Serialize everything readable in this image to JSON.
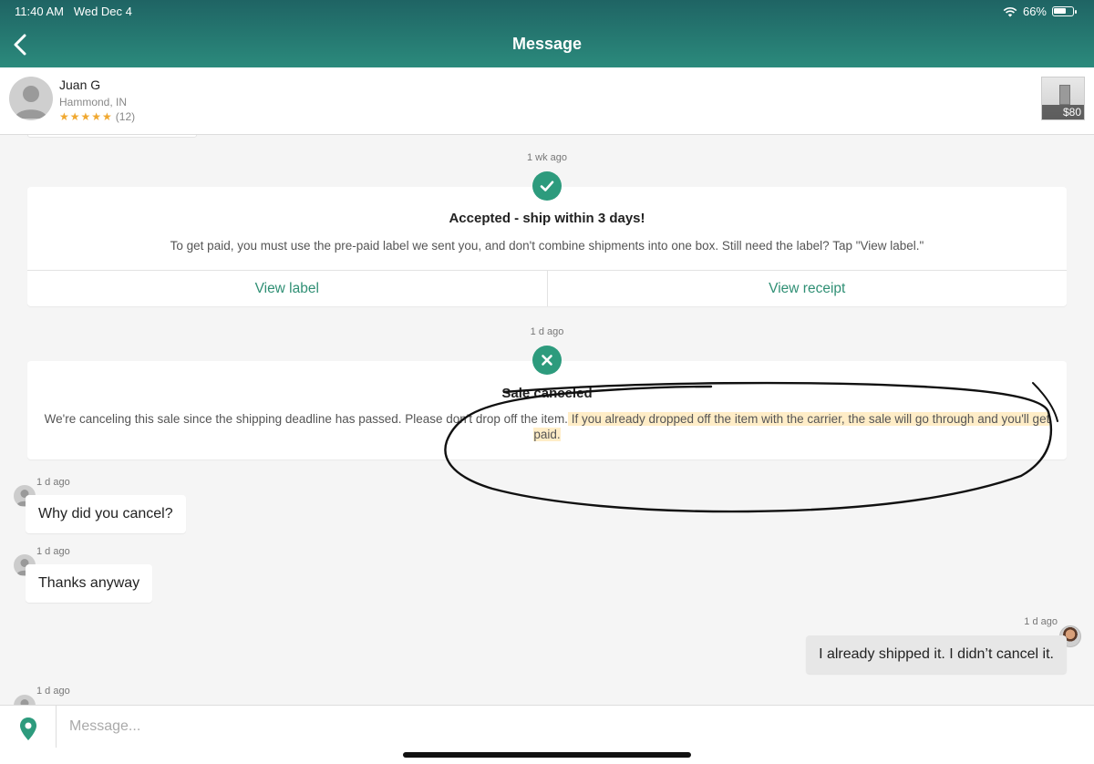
{
  "status_bar": {
    "time": "11:40 AM",
    "date": "Wed Dec 4",
    "battery": "66%"
  },
  "header": {
    "title": "Message"
  },
  "user": {
    "name": "Juan G",
    "location": "Hammond, IN",
    "rating_count": "(12)",
    "stars": 5
  },
  "item": {
    "price": "$80"
  },
  "accepted": {
    "timestamp": "1 wk ago",
    "title": "Accepted - ship within  3 days!",
    "body": "To get paid, you must use the pre-paid label we sent you, and don't combine shipments into one box. Still need the label? Tap \"View label.\"",
    "view_label": "View label",
    "view_receipt": "View receipt"
  },
  "canceled": {
    "timestamp": "1 d ago",
    "title": "Sale canceled",
    "body_part1": "We're canceling this sale since the shipping deadline has passed. Please don't drop off the item.",
    "body_part2": " If you already dropped off the item with the carrier, the sale will go through and you'll get paid."
  },
  "messages": [
    {
      "timestamp": "1 d ago",
      "text": "Why did you cancel?",
      "from": "them"
    },
    {
      "timestamp": "1 d ago",
      "text": "Thanks anyway",
      "from": "them"
    },
    {
      "timestamp": "1 d ago",
      "text": "I already shipped it. I didn’t cancel it.",
      "from": "me"
    },
    {
      "timestamp": "1 d ago",
      "text": "",
      "from": "them"
    }
  ],
  "composer": {
    "placeholder": "Message..."
  },
  "colors": {
    "header": "#2b8a7c",
    "accent": "#2f8f74",
    "status_icon": "#2d9b7d",
    "highlight": "#ffd682",
    "stars": "#f0a830"
  }
}
